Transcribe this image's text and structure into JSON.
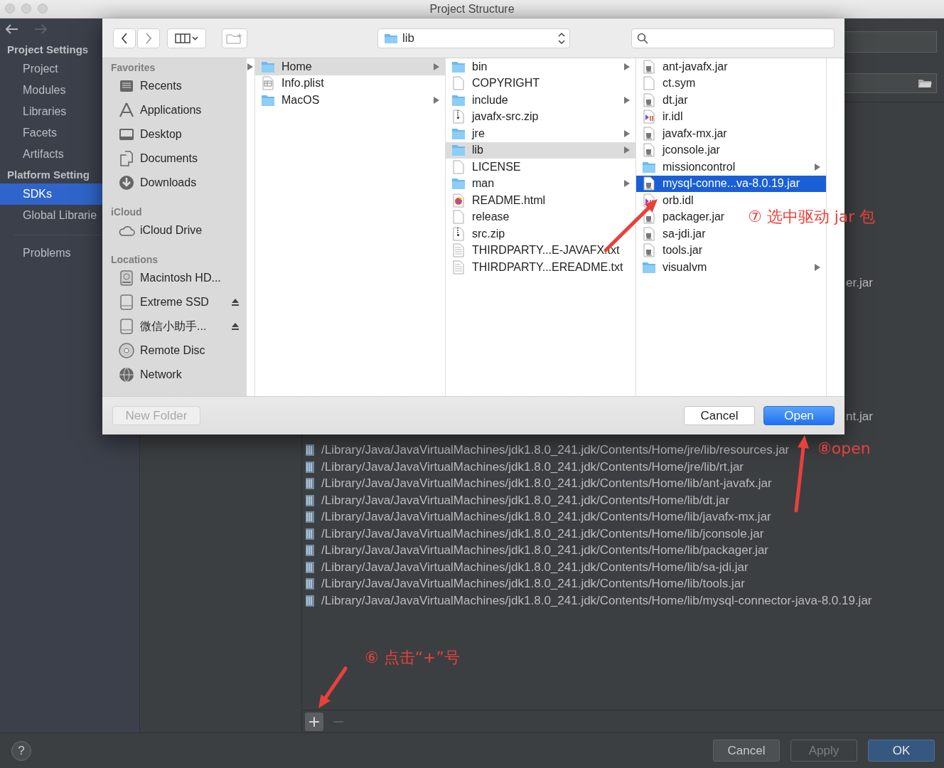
{
  "window": {
    "title": "Project Structure"
  },
  "sidebar": {
    "sections": [
      {
        "heading": "Project Settings",
        "items": [
          {
            "label": "Project",
            "selected": false
          },
          {
            "label": "Modules",
            "selected": false
          },
          {
            "label": "Libraries",
            "selected": false
          },
          {
            "label": "Facets",
            "selected": false
          },
          {
            "label": "Artifacts",
            "selected": false
          }
        ]
      },
      {
        "heading": "Platform Setting",
        "items": [
          {
            "label": "SDKs",
            "selected": true
          },
          {
            "label": "Global Librarie",
            "selected": false
          }
        ]
      },
      {
        "items": [
          {
            "label": "Problems",
            "selected": false
          }
        ]
      }
    ]
  },
  "sdk_panel": {
    "covered_rows": [
      "er.jar",
      "nt.jar"
    ],
    "paths": [
      "/Library/Java/JavaVirtualMachines/jdk1.8.0_241.jdk/Contents/Home/jre/lib/resources.jar",
      "/Library/Java/JavaVirtualMachines/jdk1.8.0_241.jdk/Contents/Home/jre/lib/rt.jar",
      "/Library/Java/JavaVirtualMachines/jdk1.8.0_241.jdk/Contents/Home/lib/ant-javafx.jar",
      "/Library/Java/JavaVirtualMachines/jdk1.8.0_241.jdk/Contents/Home/lib/dt.jar",
      "/Library/Java/JavaVirtualMachines/jdk1.8.0_241.jdk/Contents/Home/lib/javafx-mx.jar",
      "/Library/Java/JavaVirtualMachines/jdk1.8.0_241.jdk/Contents/Home/lib/jconsole.jar",
      "/Library/Java/JavaVirtualMachines/jdk1.8.0_241.jdk/Contents/Home/lib/packager.jar",
      "/Library/Java/JavaVirtualMachines/jdk1.8.0_241.jdk/Contents/Home/lib/sa-jdi.jar",
      "/Library/Java/JavaVirtualMachines/jdk1.8.0_241.jdk/Contents/Home/lib/tools.jar",
      "/Library/Java/JavaVirtualMachines/jdk1.8.0_241.jdk/Contents/Home/lib/mysql-connector-java-8.0.19.jar"
    ],
    "list_toolbar": [
      {
        "label": "+",
        "disabled": false
      },
      {
        "label": "−",
        "disabled": true
      }
    ]
  },
  "footer": {
    "help": "?",
    "buttons": [
      {
        "label": "Cancel",
        "kind": "secondary",
        "disabled": false
      },
      {
        "label": "Apply",
        "kind": "secondary",
        "disabled": true
      },
      {
        "label": "OK",
        "kind": "default",
        "disabled": false
      }
    ]
  },
  "file_dialog": {
    "location": "lib",
    "sidebar": [
      {
        "heading": "Favorites",
        "items": [
          {
            "label": "Recents",
            "kind": "recents",
            "ejectable": false
          },
          {
            "label": "Applications",
            "kind": "applications",
            "ejectable": false
          },
          {
            "label": "Desktop",
            "kind": "desktop",
            "ejectable": false
          },
          {
            "label": "Documents",
            "kind": "documents",
            "ejectable": false
          },
          {
            "label": "Downloads",
            "kind": "downloads",
            "ejectable": false
          }
        ]
      },
      {
        "heading": "iCloud",
        "items": [
          {
            "label": "iCloud Drive",
            "kind": "cloud",
            "ejectable": false
          }
        ]
      },
      {
        "heading": "Locations",
        "items": [
          {
            "label": "Macintosh HD...",
            "kind": "harddisk",
            "ejectable": false
          },
          {
            "label": "Extreme SSD",
            "kind": "drive",
            "ejectable": true
          },
          {
            "label": "微信小助手...",
            "kind": "drive",
            "ejectable": true
          },
          {
            "label": "Remote Disc",
            "kind": "disc",
            "ejectable": false
          },
          {
            "label": "Network",
            "kind": "network",
            "ejectable": false
          }
        ]
      }
    ],
    "columns": [
      {
        "focused": false,
        "items": [
          {
            "name": "Home",
            "kind": "folder",
            "selected": true
          },
          {
            "name": "Info.plist",
            "kind": "plist",
            "selected": false
          },
          {
            "name": "MacOS",
            "kind": "folder",
            "selected": false
          }
        ]
      },
      {
        "focused": false,
        "items": [
          {
            "name": "bin",
            "kind": "folder",
            "selected": false
          },
          {
            "name": "COPYRIGHT",
            "kind": "file",
            "selected": false
          },
          {
            "name": "include",
            "kind": "folder",
            "selected": false
          },
          {
            "name": "javafx-src.zip",
            "kind": "zip",
            "selected": false
          },
          {
            "name": "jre",
            "kind": "folder",
            "selected": false
          },
          {
            "name": "lib",
            "kind": "folder",
            "selected": true
          },
          {
            "name": "LICENSE",
            "kind": "file",
            "selected": false
          },
          {
            "name": "man",
            "kind": "folder",
            "selected": false
          },
          {
            "name": "README.html",
            "kind": "html",
            "selected": false
          },
          {
            "name": "release",
            "kind": "file",
            "selected": false
          },
          {
            "name": "src.zip",
            "kind": "zip",
            "selected": false
          },
          {
            "name": "THIRDPARTY...E-JAVAFX.txt",
            "kind": "text",
            "selected": false
          },
          {
            "name": "THIRDPARTY...EREADME.txt",
            "kind": "text",
            "selected": false
          }
        ]
      },
      {
        "focused": true,
        "items": [
          {
            "name": "ant-javafx.jar",
            "kind": "jar",
            "selected": false
          },
          {
            "name": "ct.sym",
            "kind": "file",
            "selected": false
          },
          {
            "name": "dt.jar",
            "kind": "jar",
            "selected": false
          },
          {
            "name": "ir.idl",
            "kind": "idl",
            "selected": false
          },
          {
            "name": "javafx-mx.jar",
            "kind": "jar",
            "selected": false
          },
          {
            "name": "jconsole.jar",
            "kind": "jar",
            "selected": false
          },
          {
            "name": "missioncontrol",
            "kind": "folder",
            "selected": false
          },
          {
            "name": "mysql-conne...va-8.0.19.jar",
            "kind": "jar",
            "selected": true
          },
          {
            "name": "orb.idl",
            "kind": "idl",
            "selected": false
          },
          {
            "name": "packager.jar",
            "kind": "jar",
            "selected": false
          },
          {
            "name": "sa-jdi.jar",
            "kind": "jar",
            "selected": false
          },
          {
            "name": "tools.jar",
            "kind": "jar",
            "selected": false
          },
          {
            "name": "visualvm",
            "kind": "folder",
            "selected": false
          }
        ]
      }
    ],
    "buttons": [
      {
        "label": "New Folder",
        "kind": "secondary",
        "disabled": true
      },
      {
        "label": "Cancel",
        "kind": "secondary",
        "disabled": false
      },
      {
        "label": "Open",
        "kind": "default",
        "disabled": false
      }
    ]
  },
  "annotations": [
    {
      "text": "⑦ 选中驱动 jar 包"
    },
    {
      "text": "⑧open"
    },
    {
      "text": "⑥ 点击“+”号"
    }
  ]
}
